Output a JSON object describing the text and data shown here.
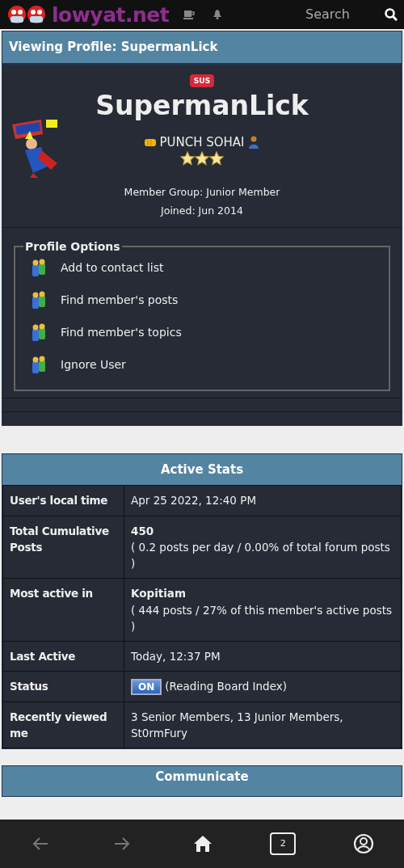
{
  "topbar": {
    "logo": "lowyat.net",
    "search": {
      "placeholder": "Search"
    }
  },
  "profile": {
    "title": "Viewing Profile: SupermanLick",
    "badge": "SUS",
    "username": "SupermanLick",
    "rank": "PUNCH SOHAI",
    "stars": 3,
    "member_group": "Member Group: Junior Member",
    "joined": "Joined: Jun 2014",
    "options_title": "Profile Options",
    "options": [
      "Add to contact list",
      "Find member's posts",
      "Find member's topics",
      "Ignore User"
    ]
  },
  "active_stats": {
    "title": "Active Stats",
    "rows": [
      {
        "kind": "text",
        "label": "User's local time",
        "value": "Apr 25 2022, 12:40 PM"
      },
      {
        "kind": "detail",
        "label": "Total Cumulative Posts",
        "value": "450",
        "detail": "( 0.2 posts per day / 0.00% of total forum posts )"
      },
      {
        "kind": "detail",
        "label": "Most active in",
        "value": "Kopitiam",
        "detail": "( 444 posts / 27% of this member's active posts )"
      },
      {
        "kind": "text",
        "label": "Last Active",
        "value": "Today, 12:37 PM"
      },
      {
        "kind": "status",
        "label": "Status",
        "badge": "ON",
        "on": true,
        "value": "(Reading Board Index)"
      },
      {
        "kind": "text",
        "label": "Recently viewed me",
        "value": "3 Senior Members, 13 Junior Members, St0rmFury"
      }
    ]
  },
  "communicate": {
    "title": "Communicate"
  },
  "bottom_nav": [
    {
      "kind": "back",
      "disabled": true
    },
    {
      "kind": "forward",
      "disabled": true
    },
    {
      "kind": "home",
      "disabled": false
    },
    {
      "kind": "tabs",
      "count": "2",
      "disabled": false
    },
    {
      "kind": "account",
      "disabled": false
    }
  ]
}
